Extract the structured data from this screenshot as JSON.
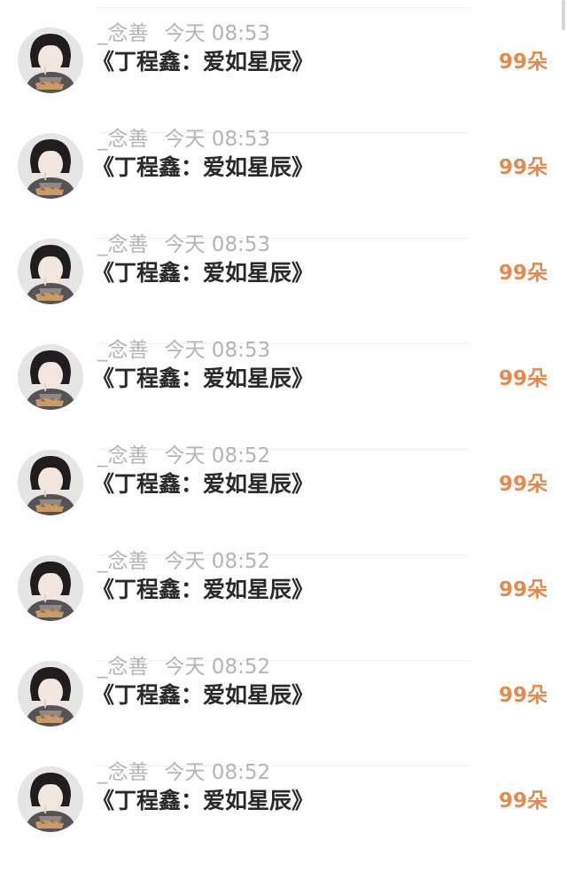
{
  "colors": {
    "background": "#ffffff",
    "meta_text": "#b4b4b4",
    "title_text": "#2a2a2a",
    "gift_text": "#e28a4f",
    "divider": "#f0f0f0"
  },
  "list": {
    "items": [
      {
        "avatar_icon": "user-avatar-icon",
        "username": "_念善",
        "time": "今天 08:53",
        "title": "《丁程鑫：爱如星辰》",
        "gift": "99朵"
      },
      {
        "avatar_icon": "user-avatar-icon",
        "username": "_念善",
        "time": "今天 08:53",
        "title": "《丁程鑫：爱如星辰》",
        "gift": "99朵"
      },
      {
        "avatar_icon": "user-avatar-icon",
        "username": "_念善",
        "time": "今天 08:53",
        "title": "《丁程鑫：爱如星辰》",
        "gift": "99朵"
      },
      {
        "avatar_icon": "user-avatar-icon",
        "username": "_念善",
        "time": "今天 08:53",
        "title": "《丁程鑫：爱如星辰》",
        "gift": "99朵"
      },
      {
        "avatar_icon": "user-avatar-icon",
        "username": "_念善",
        "time": "今天 08:52",
        "title": "《丁程鑫：爱如星辰》",
        "gift": "99朵"
      },
      {
        "avatar_icon": "user-avatar-icon",
        "username": "_念善",
        "time": "今天 08:52",
        "title": "《丁程鑫：爱如星辰》",
        "gift": "99朵"
      },
      {
        "avatar_icon": "user-avatar-icon",
        "username": "_念善",
        "time": "今天 08:52",
        "title": "《丁程鑫：爱如星辰》",
        "gift": "99朵"
      },
      {
        "avatar_icon": "user-avatar-icon",
        "username": "_念善",
        "time": "今天 08:52",
        "title": "《丁程鑫：爱如星辰》",
        "gift": "99朵"
      }
    ]
  }
}
